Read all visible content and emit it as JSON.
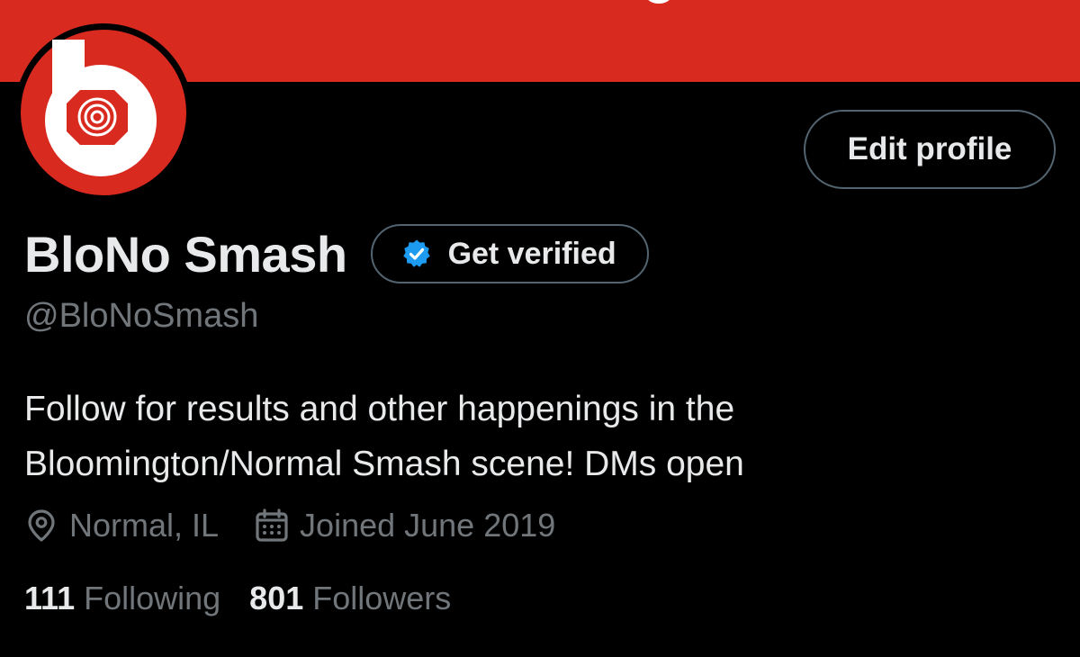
{
  "profile": {
    "display_name": "BloNo Smash",
    "handle": "@BloNoSmash",
    "bio_lines": [
      "Follow for results and other happenings in the",
      "Bloomington/Normal Smash scene! DMs open"
    ],
    "location": "Normal, IL",
    "joined": "Joined June 2019"
  },
  "actions": {
    "edit_profile_label": "Edit profile",
    "get_verified_label": "Get verified"
  },
  "stats": {
    "following_count": "111",
    "following_label": "Following",
    "followers_count": "801",
    "followers_label": "Followers"
  },
  "icons": {
    "avatar": "smash-logo-b-avatar",
    "verified": "verified-badge-icon",
    "location": "location-pin-icon",
    "joined": "calendar-icon"
  },
  "colors": {
    "banner": "#d92a1f",
    "background": "#000000",
    "primary_text": "#e7e9ea",
    "secondary_text": "#71767b",
    "border": "#536471",
    "verified_blue": "#1d9bf0"
  }
}
